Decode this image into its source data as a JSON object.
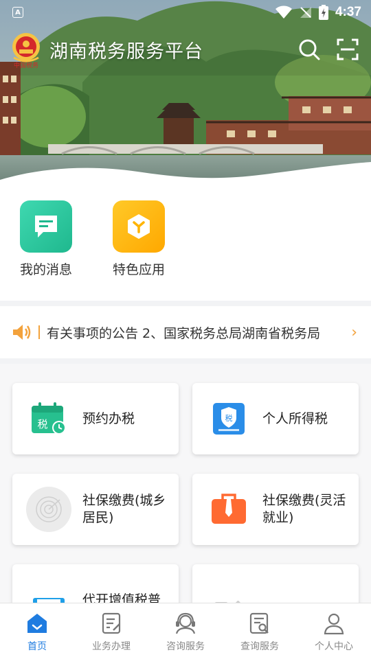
{
  "status_bar": {
    "time": "4:37",
    "app_indicator": "A"
  },
  "header": {
    "title": "湖南税务服务平台",
    "emblem_text": "中国税务",
    "search_icon": "search-icon",
    "scan_icon": "scan-icon"
  },
  "quick_actions": [
    {
      "label": "我的消息",
      "icon": "message-icon",
      "color": "#2fc7a0"
    },
    {
      "label": "特色应用",
      "icon": "cube-icon",
      "color": "#ffb400"
    }
  ],
  "notice": {
    "text": "有关事项的公告 2、国家税务总局湖南省税务局",
    "icon": "speaker-icon",
    "accent": "#f3a23c"
  },
  "services": [
    {
      "label": "预约办税",
      "icon": "tax-calendar-icon"
    },
    {
      "label": "个人所得税",
      "icon": "personal-tax-icon"
    },
    {
      "label": "社保缴费(城乡居民)",
      "icon": "radar-icon"
    },
    {
      "label": "社保缴费(灵活就业)",
      "icon": "briefcase-icon"
    },
    {
      "label": "代开增值税普",
      "icon": "printer-icon"
    },
    {
      "label": "更多",
      "icon": "more-icon"
    }
  ],
  "bottom_nav": [
    {
      "label": "首页",
      "icon": "home-icon",
      "active": true
    },
    {
      "label": "业务办理",
      "icon": "document-edit-icon",
      "active": false
    },
    {
      "label": "咨询服务",
      "icon": "headset-icon",
      "active": false
    },
    {
      "label": "查询服务",
      "icon": "document-search-icon",
      "active": false
    },
    {
      "label": "个人中心",
      "icon": "person-icon",
      "active": false
    }
  ],
  "colors": {
    "brand_blue": "#1f7ce0",
    "inactive": "#888888"
  }
}
